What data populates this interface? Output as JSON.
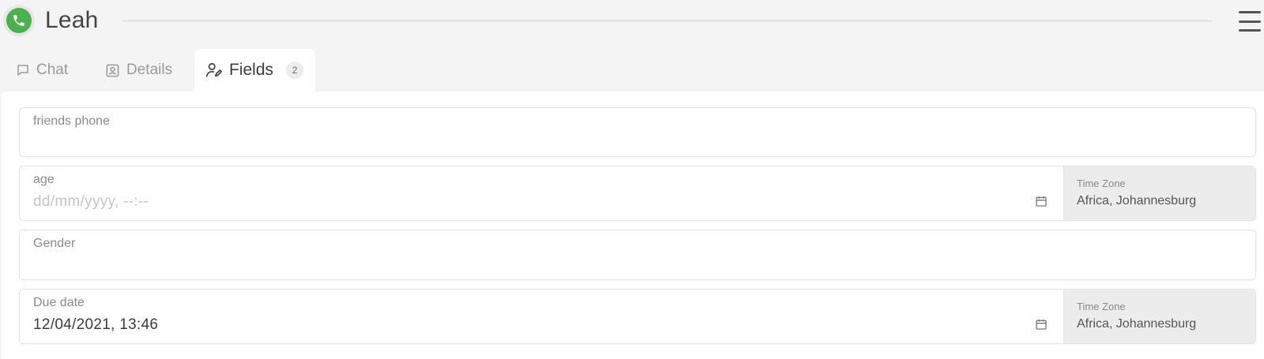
{
  "header": {
    "contact_name": "Leah",
    "avatar_color": "#4caf50"
  },
  "tabs": [
    {
      "label": "Chat",
      "icon": "chat-bubble-icon",
      "active": false
    },
    {
      "label": "Details",
      "icon": "contact-card-icon",
      "active": false
    },
    {
      "label": "Fields",
      "icon": "user-edit-icon",
      "active": true,
      "badge": "2"
    }
  ],
  "fields": {
    "friends_phone": {
      "label": "friends phone",
      "value": ""
    },
    "age": {
      "label": "age",
      "placeholder": "dd/mm/yyyy, --:--",
      "timezone_label": "Time Zone",
      "timezone_value": "Africa, Johannesburg"
    },
    "gender": {
      "label": "Gender",
      "value": ""
    },
    "due_date": {
      "label": "Due date",
      "value": "12/04/2021, 13:46",
      "timezone_label": "Time Zone",
      "timezone_value": "Africa, Johannesburg"
    }
  }
}
